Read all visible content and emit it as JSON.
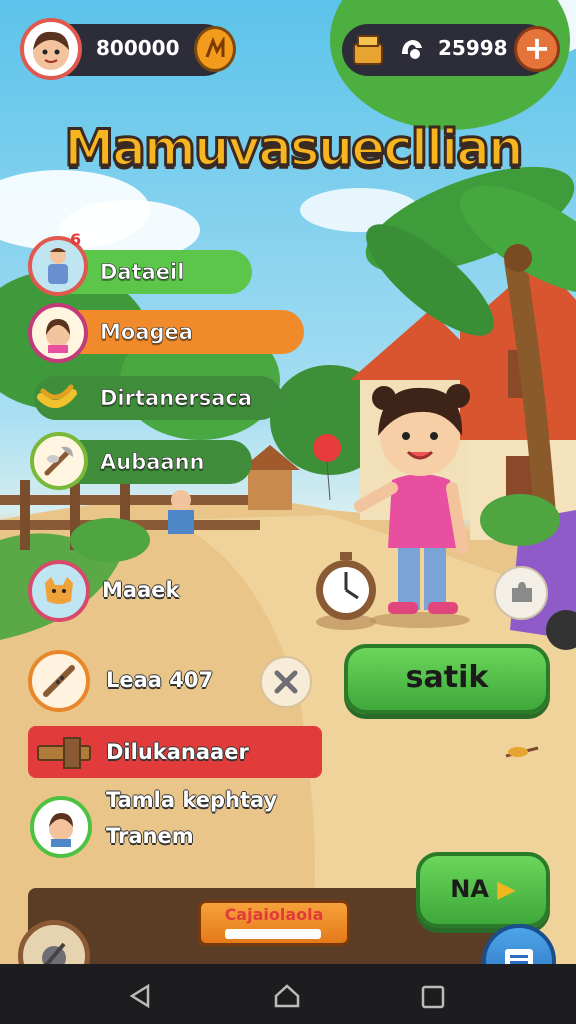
{
  "header": {
    "coins": "800000",
    "gems": "25998",
    "add_label": "+"
  },
  "title": "Mamuvasuecllian",
  "menu": [
    {
      "label": "Dataeil",
      "color": "#5cc64a",
      "icon": "villager-icon",
      "badge": "6"
    },
    {
      "label": "Moagea",
      "color": "#f08a2a",
      "icon": "girl-avatar-icon"
    },
    {
      "label": "Dirtanersaca",
      "color": "#3f8d3a",
      "icon": "bananas-icon"
    },
    {
      "label": "Aubaann",
      "color": "#3f8d3a",
      "icon": "tools-icon"
    }
  ],
  "side_items": {
    "maaek": "Maaek",
    "leaa": "Leaa 407",
    "dilukanaaer": "Dilukanaaer",
    "tamla_line1": "Tamla kephtay",
    "tamla_line2": "Tranem"
  },
  "buttons": {
    "start": "satik",
    "next": "NA",
    "banner": "Cajaiolaola"
  },
  "colors": {
    "accent_green": "#4cc142",
    "accent_orange": "#f08a2a",
    "accent_red": "#e23b3b",
    "dark_pill": "#2d2d3a"
  }
}
